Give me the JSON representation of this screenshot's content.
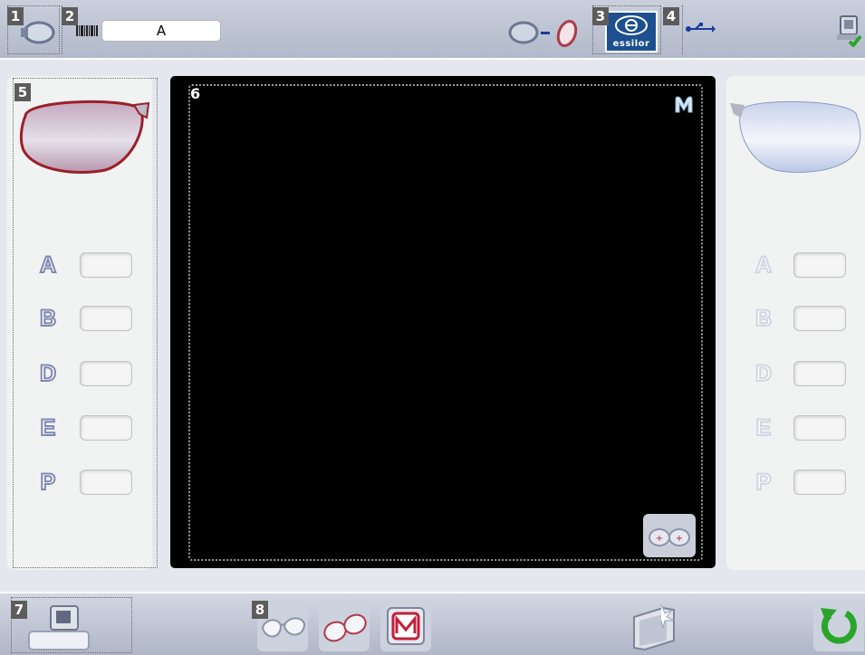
{
  "header": {
    "callouts": [
      "1",
      "2",
      "3",
      "4"
    ],
    "job_field_value": "A",
    "brand_logo_text": "essilor"
  },
  "left_panel": {
    "callout": "5",
    "fields": [
      {
        "label": "A",
        "value": ""
      },
      {
        "label": "B",
        "value": ""
      },
      {
        "label": "D",
        "value": ""
      },
      {
        "label": "E",
        "value": ""
      },
      {
        "label": "P",
        "value": ""
      }
    ]
  },
  "right_panel": {
    "fields": [
      {
        "label": "A",
        "value": ""
      },
      {
        "label": "B",
        "value": ""
      },
      {
        "label": "D",
        "value": ""
      },
      {
        "label": "E",
        "value": ""
      },
      {
        "label": "P",
        "value": ""
      }
    ]
  },
  "display": {
    "callout": "6"
  },
  "footer": {
    "callouts": [
      "7",
      "8"
    ]
  },
  "colors": {
    "bar_gradient_top": "#c9cfdc",
    "bar_gradient_bottom": "#b2b9ca",
    "display_background": "#000000",
    "brand_blue": "#1e4f8f",
    "left_lens_rim": "#9b1f2a",
    "accept_green": "#2aa52a"
  },
  "icons": {
    "tracer": "tracer-device-icon",
    "barcode": "barcode-icon",
    "frame_lens": "frame-to-lens-icon",
    "usb": "usb-icon",
    "network_status": "network-computer-icon",
    "display_mode": "m-logo-icon",
    "binocular": "binocular-lenses-icon",
    "footer_tracer": "tracer-station-icon",
    "half_rim": "half-rim-frame-icon",
    "full_rim": "full-rim-frame-icon",
    "shape_edit": "shape-modify-icon",
    "fast_forward": "fast-shape-icon",
    "reset": "reset-icon"
  }
}
